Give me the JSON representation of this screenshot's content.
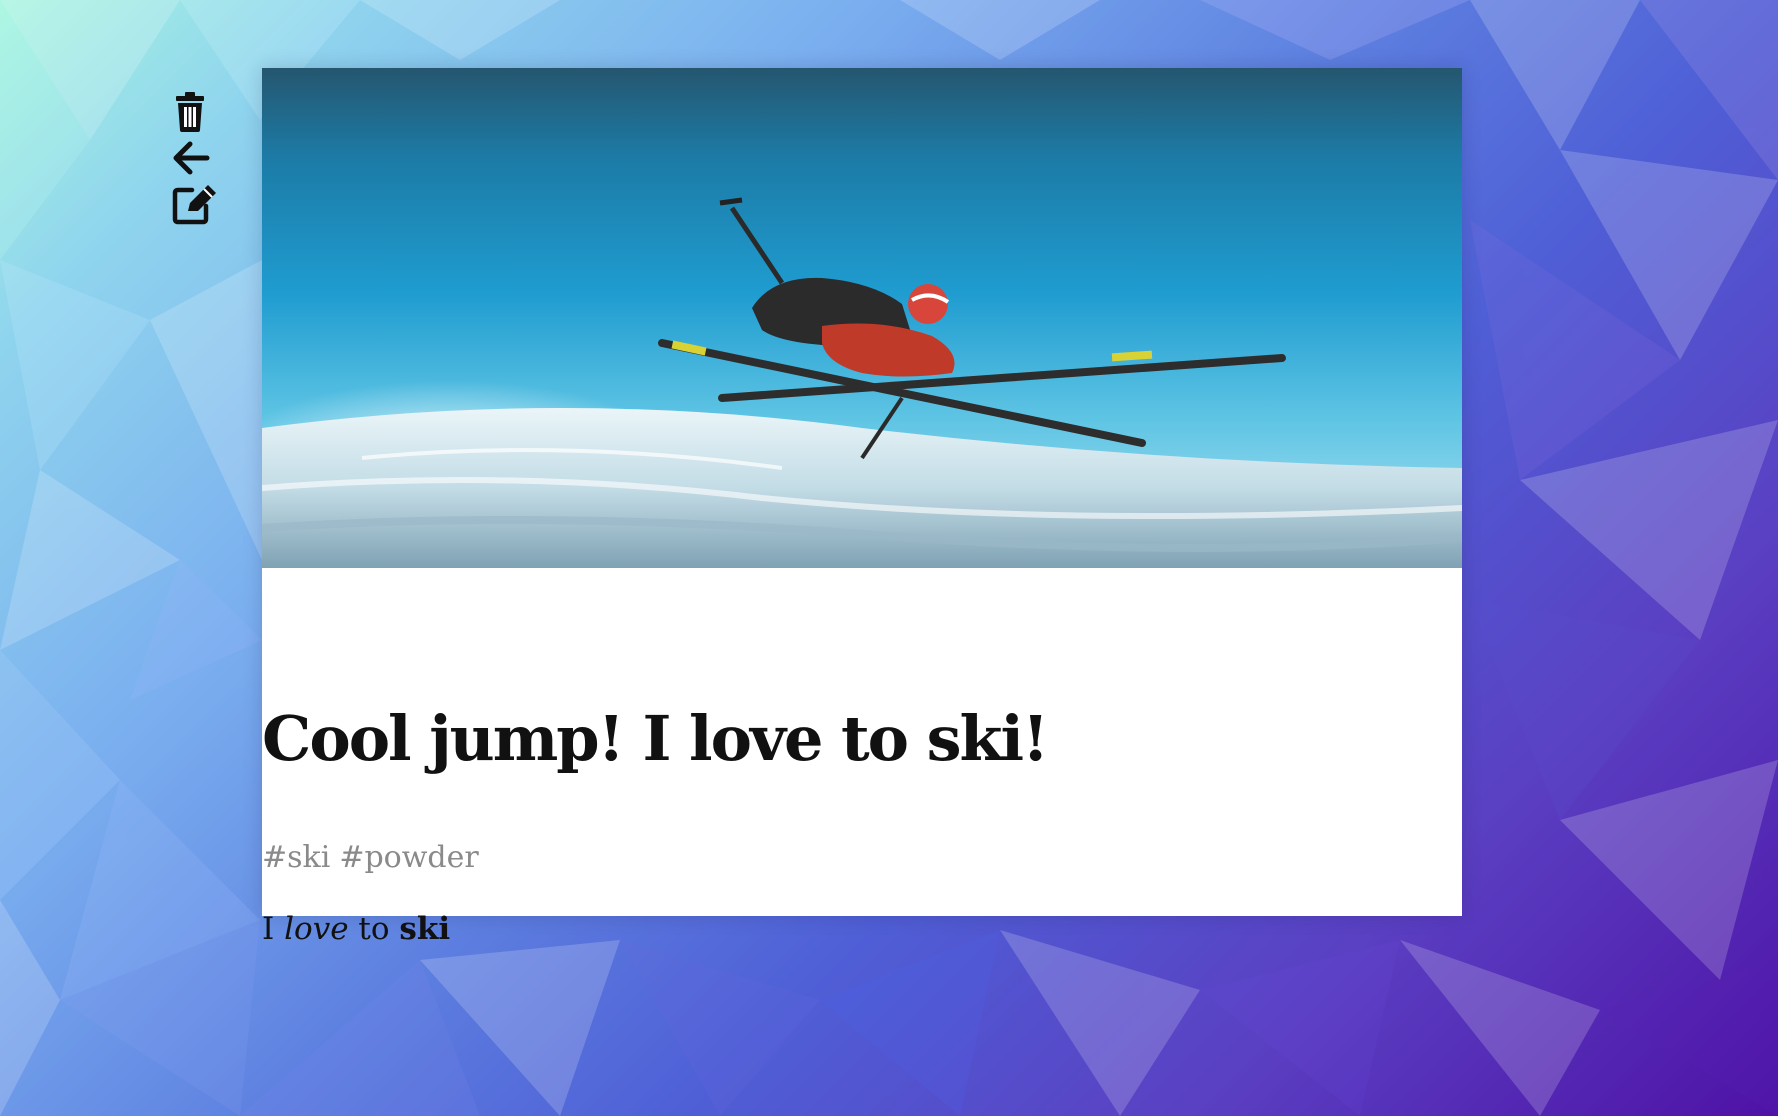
{
  "toolbar": {
    "icons": [
      "trash-icon",
      "arrow-left-icon",
      "edit-icon"
    ]
  },
  "post": {
    "image": "skier mid-air jumping over snow against blue sky",
    "title": "Cool jump! I love to ski!",
    "tags": [
      "#ski",
      "#powder"
    ],
    "body": {
      "part1": "I ",
      "part2_italic": "love",
      "part3": " to ",
      "part4_bold": "ski"
    }
  },
  "colors": {
    "tag_gray": "#8a8a8a",
    "card_bg": "#ffffff",
    "sky_blue": "#2a9fce"
  }
}
